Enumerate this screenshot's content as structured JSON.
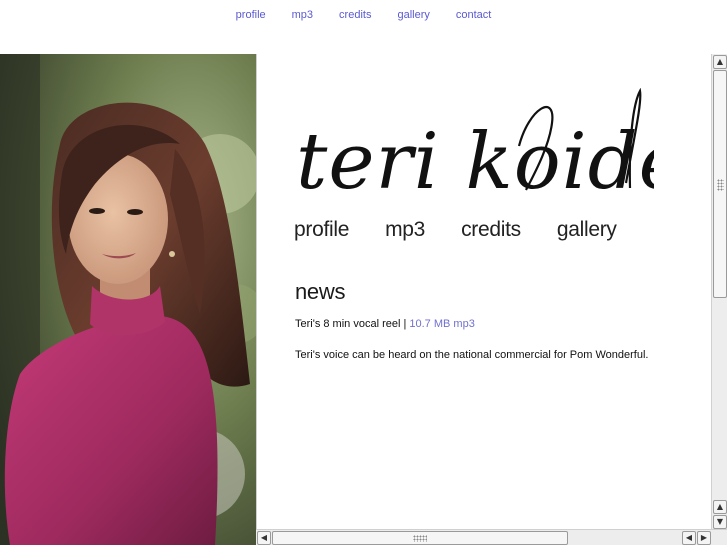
{
  "topnav": [
    "profile",
    "mp3",
    "credits",
    "gallery",
    "contact"
  ],
  "logo_text": "teri koide",
  "mainnav": [
    "profile",
    "mp3",
    "credits",
    "gallery"
  ],
  "news": {
    "title": "news",
    "item1_text": "Teri's 8 min vocal reel | ",
    "item1_link": "10.7 MB mp3",
    "item2_text": "Teri's voice can be heard on the national commercial for Pom Wonderful."
  },
  "colors": {
    "link": "#5a5ad0",
    "news_link": "#7070d0",
    "text": "#222222"
  },
  "icons": {
    "scroll_up": "▲",
    "scroll_down": "▼",
    "scroll_left": "◀",
    "scroll_right": "▶"
  }
}
